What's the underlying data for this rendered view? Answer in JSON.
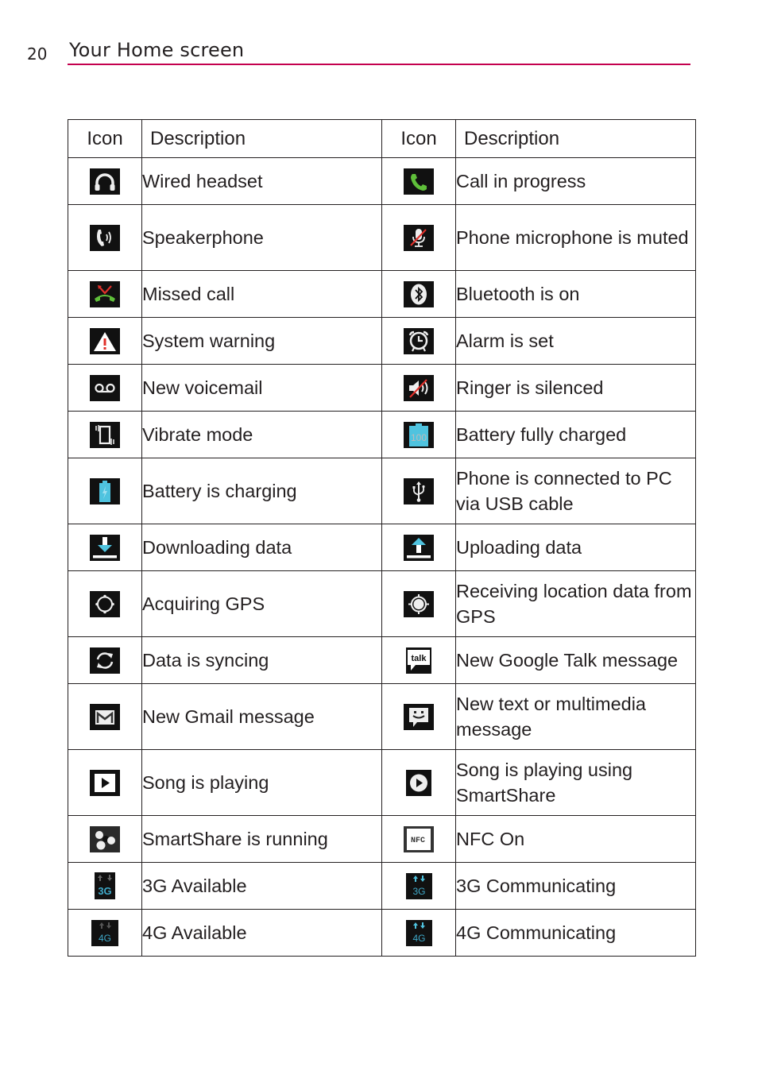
{
  "page": {
    "number": "20",
    "section_title": "Your Home screen",
    "accent_color": "#c4004e"
  },
  "table": {
    "headers": [
      "Icon",
      "Description",
      "Icon",
      "Description"
    ],
    "rows": [
      {
        "left": {
          "icon": "wired-headset-icon",
          "desc": "Wired headset"
        },
        "right": {
          "icon": "call-in-progress-icon",
          "desc": "Call in progress"
        }
      },
      {
        "left": {
          "icon": "speakerphone-icon",
          "desc": "Speakerphone"
        },
        "right": {
          "icon": "microphone-muted-icon",
          "desc": "Phone microphone is muted"
        }
      },
      {
        "left": {
          "icon": "missed-call-icon",
          "desc": "Missed call"
        },
        "right": {
          "icon": "bluetooth-icon",
          "desc": "Bluetooth is on"
        }
      },
      {
        "left": {
          "icon": "system-warning-icon",
          "desc": "System warning"
        },
        "right": {
          "icon": "alarm-icon",
          "desc": "Alarm is set"
        }
      },
      {
        "left": {
          "icon": "voicemail-icon",
          "desc": "New voicemail"
        },
        "right": {
          "icon": "ringer-silenced-icon",
          "desc": "Ringer is silenced"
        }
      },
      {
        "left": {
          "icon": "vibrate-icon",
          "desc": "Vibrate mode"
        },
        "right": {
          "icon": "battery-full-icon",
          "desc": "Battery fully charged",
          "label": "100"
        }
      },
      {
        "left": {
          "icon": "battery-charging-icon",
          "desc": "Battery is charging"
        },
        "right": {
          "icon": "usb-icon",
          "desc": "Phone is connected to PC via USB cable"
        }
      },
      {
        "left": {
          "icon": "download-icon",
          "desc": "Downloading data"
        },
        "right": {
          "icon": "upload-icon",
          "desc": "Uploading data"
        }
      },
      {
        "left": {
          "icon": "gps-acquiring-icon",
          "desc": "Acquiring GPS"
        },
        "right": {
          "icon": "gps-receiving-icon",
          "desc": "Receiving location data from GPS"
        }
      },
      {
        "left": {
          "icon": "sync-icon",
          "desc": "Data is syncing"
        },
        "right": {
          "icon": "google-talk-icon",
          "desc": "New Google Talk message",
          "label": "talk"
        }
      },
      {
        "left": {
          "icon": "gmail-icon",
          "desc": "New Gmail message"
        },
        "right": {
          "icon": "sms-icon",
          "desc": "New text or multimedia message"
        }
      },
      {
        "left": {
          "icon": "song-playing-icon",
          "desc": "Song is playing"
        },
        "right": {
          "icon": "smartshare-song-icon",
          "desc": "Song is playing using SmartShare"
        }
      },
      {
        "left": {
          "icon": "smartshare-icon",
          "desc": "SmartShare is running"
        },
        "right": {
          "icon": "nfc-icon",
          "desc": "NFC On",
          "label": "NFC"
        }
      },
      {
        "left": {
          "icon": "3g-available-icon",
          "desc": "3G Available",
          "label": "3G"
        },
        "right": {
          "icon": "3g-communicating-icon",
          "desc": "3G Communicating",
          "label": "3G"
        }
      },
      {
        "left": {
          "icon": "4g-available-icon",
          "desc": "4G Available",
          "label": "4G"
        },
        "right": {
          "icon": "4g-communicating-icon",
          "desc": "4G Communicating",
          "label": "4G"
        }
      }
    ]
  },
  "colors": {
    "icon_bg": "#111111",
    "call_green": "#5fbf3a",
    "mute_red": "#e0302a",
    "battery_blue": "#4fc3df",
    "network_blue": "#3fa9c9"
  }
}
